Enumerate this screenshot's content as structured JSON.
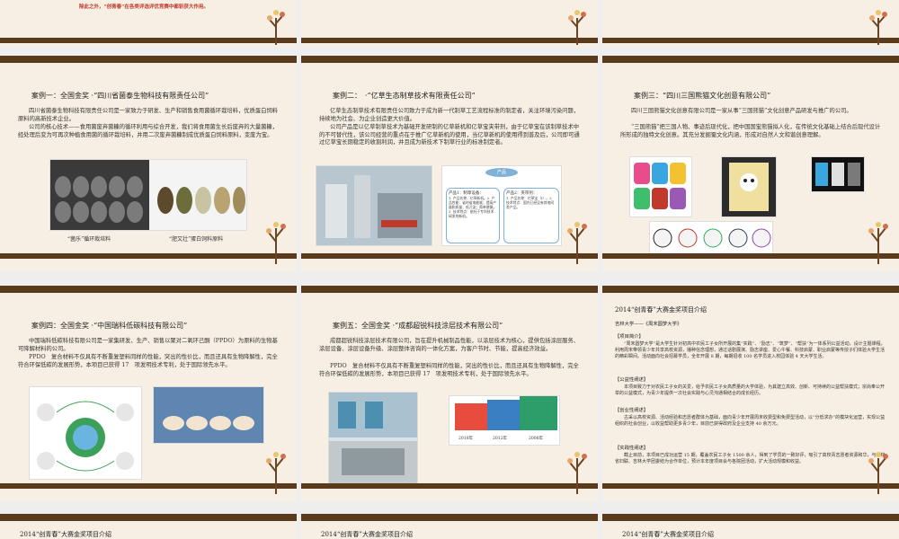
{
  "top_note": "除此之外，“创青春”在各类评选评优竞赛中都斩获大作用。",
  "case1": {
    "title": "案例一：全国金奖 ·“四川省菌泰生物科技有限责任公司”",
    "p1": "四川省菌泰生物科技有限责任公司是一家致力于研发、生产和销售食用菌循环栽培料，优质蛋白饲料原料的高新技术企业。",
    "p2": "公司的核心技术——食用菌废弃菌糠的循环利用与综合开发，我们将食用菌生长后废弃的大量菌糠，经处理后变为可再次种植食用菌的循环栽培料，并用二次废弃菌糠制成优质蛋白饲料原料，变废为宝。",
    "cap_left": "“菌乐”循环栽培料",
    "cap_right": "“肥又壮”蛋白饲料原料"
  },
  "case2": {
    "title": "案例二：　·“亿草生态制草技术有限责任公司”",
    "p1": "亿草生态制草技术有限责任公司致力于成为新一代制草工艺流程标准的制定者，关注环境污染问题，持续地为社会、为企业创造更大价值。",
    "p2": "公司产品是以亿草制草技术为基础开发研制的亿草新机和亿草宝夹带剂，由于亿草宝在该制草技术中的不可替代性，该公司经营的重点在于推广亿草新机的使用，当亿草新机的使用得到普及后，公司即可通过亿草宝长期稳定的收割利润，并且成为新技术下制草行业的标准制定者。",
    "diagram_top": "产品",
    "diagram_left_title": "产品1：制草设备：",
    "diagram_left": "1. 产品名称：亿草新机。2. 产品性能：省时省电能耗；提高产量和质量；低污染；简单便捷。3. 技术特点：依托于专利技术研发的新机。",
    "diagram_right_title": "产品2：夹带剂：",
    "diagram_right": "1. 产品名称：亿草宝（I）。2. 技术特点：国内已经没有其他同类产品。"
  },
  "case3": {
    "title": "案例三：“四川三国熊猫文化创意有限公司”",
    "p1": "四川三国熊猫文化创意有限公司是一家从事“三国熊猫”文化创意产品研发与推广的公司。",
    "p2": "“三国熊猫”把三国人物、事迹后现代化，把中国国宝熊猫拟人化，在传统文化基础上结合后现代设计所形成的独特文化创意。其充分发掘蜀文化内涵，形成对自然人文和谐创意理解。"
  },
  "case4": {
    "title": "案例四：全国金奖 ·“中国瑞科低碳科技有限公司”",
    "p1": "中国瑞科低碳科技有限公司是一家集研发、生产、销售以聚对二氧环己酮（PPDO）为原料的生物基可降解材料的公司。",
    "p2": "PPDO　复合材料不仅具有不断重复塑料同样的性能，突出的性价比，而且还具有生物降解性，完全符合环保低碳的发展形势，本项目已获得 17　项发明技术专利，处于国际领先水平。"
  },
  "case5": {
    "title": "案例五：全国金奖 ·“成都超锐科技涂层技术有限公司”",
    "p1": "成都超锐科技涂层技术有限公司，旨在提升机械制品性能，以涂层技术为核心，提供包括涂层服务、涂层设备、涂层设备升级、涂层整体咨询的一体化方案，为客户节时、节能，提高经济效益。",
    "p2": "PPDO　复合材料不仅具有不断重复塑料同样的性能，突出的性价比，而且还具有生物降解性，完全符合环保低碳的发展形势，本项目已获得 17　项发明技术专利，处于国际领先水平。",
    "years": [
      "2010年",
      "2012年",
      "2006年"
    ]
  },
  "award": {
    "title": "2014“创青春”大赛金奖项目介绍",
    "school": "吉林大学——《周末圆梦大学》",
    "h1": "【项目简介】",
    "t1": "“周末圆梦大学”是大学生针对初高中农民工子女所开展的集“实践”、“励志”、“筑梦”、“帮扶”为一体系列公益活动，设计主题课程，利用周末带领青少年共享高校资源，播种信念理想，通过话剧展演、励志讲座、爱心午餐、科技启蒙、职业启蒙等传授子们体验大学生活的精彩瞬间。活动面向社会招募学员，全年开展 8 期，每期招收 100 名学员进入校园体验 4 天大学生活。",
    "h2": "【公益性阐述】",
    "t2": "本项目致力于对农民工子女的关爱，给予农民工子女高质量的大学体验，为其建立高效、创新、可持续的公益帮扶模式；宗尚奉公开举的公益模式，为青少年提供一次社会实践与心灵沟通相结合的成长经历。",
    "h3": "【创业性阐述】",
    "t3": "古采以高校资源、活动经验和志愿者群体为基础，面向青少年开展周末收费型和免费型活动，以“分低求办”的模块化运营，实现公益组织的社会创业，以收益帮助更多青少年，目前已获得政府及企业支持 40 余万元。",
    "h4": "【实践性阐述】",
    "t4": "截止目前，本项目已成功运营 15 期，覆盖农民工子女 1500 余人，得到了学员的一致好评，吸引了高校青志愿者资源和华，与吉林省妇联、吉林大学团委结为合作单位，预计本年度项目会与各院团活动，扩大活动规模和收益。"
  },
  "bottom_titles": [
    "2014“创青春”大赛金奖项目介绍",
    "2014“创青春”大赛金奖项目介绍",
    "2014“创青春”大赛金奖项目介绍"
  ]
}
